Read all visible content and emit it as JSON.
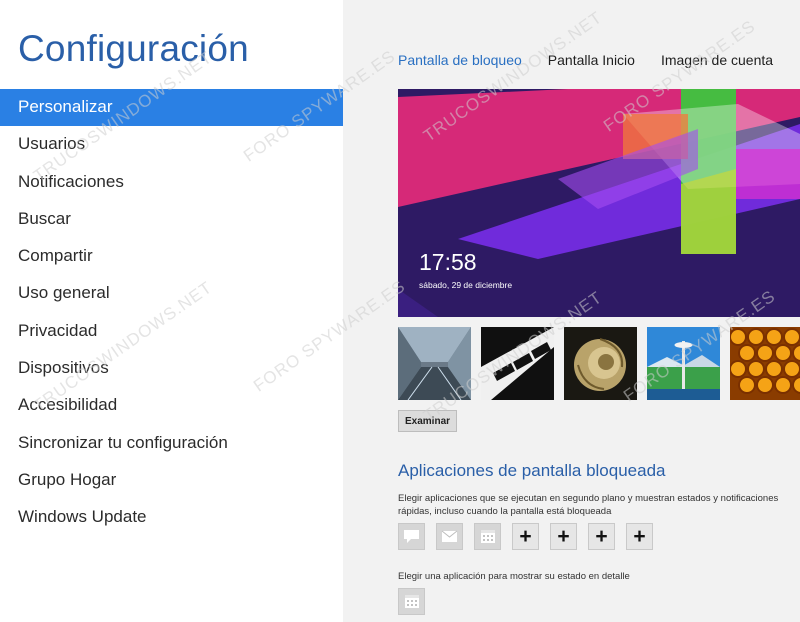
{
  "app": {
    "title": "Configuración"
  },
  "menu": {
    "items": [
      {
        "label": "Personalizar",
        "selected": true
      },
      {
        "label": "Usuarios",
        "selected": false
      },
      {
        "label": "Notificaciones",
        "selected": false
      },
      {
        "label": "Buscar",
        "selected": false
      },
      {
        "label": "Compartir",
        "selected": false
      },
      {
        "label": "Uso general",
        "selected": false
      },
      {
        "label": "Privacidad",
        "selected": false
      },
      {
        "label": "Dispositivos",
        "selected": false
      },
      {
        "label": "Accesibilidad",
        "selected": false
      },
      {
        "label": "Sincronizar tu configuración",
        "selected": false
      },
      {
        "label": "Grupo Hogar",
        "selected": false
      },
      {
        "label": "Windows Update",
        "selected": false
      }
    ]
  },
  "tabs": [
    {
      "label": "Pantalla de bloqueo",
      "active": true
    },
    {
      "label": "Pantalla Inicio",
      "active": false
    },
    {
      "label": "Imagen de cuenta",
      "active": false
    }
  ],
  "lock_preview": {
    "time": "17:58",
    "date": "sábado, 29 de diciembre"
  },
  "thumbnails": [
    {
      "name": "tunnel-thumbnail"
    },
    {
      "name": "piano-thumbnail"
    },
    {
      "name": "nautilus-thumbnail"
    },
    {
      "name": "space-needle-thumbnail"
    },
    {
      "name": "honeycomb-thumbnail"
    }
  ],
  "browse_button": "Examinar",
  "lock_apps": {
    "title": "Aplicaciones de pantalla bloqueada",
    "description": "Elegir aplicaciones que se ejecutan en segundo plano y muestran estados y notificaciones rápidas, incluso cuando la pantalla está bloqueada",
    "slots": [
      {
        "icon": "message-icon",
        "type": "app"
      },
      {
        "icon": "mail-icon",
        "type": "app"
      },
      {
        "icon": "calendar-icon",
        "type": "app"
      },
      {
        "icon": "plus-icon",
        "type": "add",
        "label": "+"
      },
      {
        "icon": "plus-icon",
        "type": "add",
        "label": "+"
      },
      {
        "icon": "plus-icon",
        "type": "add",
        "label": "+"
      },
      {
        "icon": "plus-icon",
        "type": "add",
        "label": "+"
      }
    ],
    "detail_description": "Elegir una aplicación para mostrar su estado en detalle",
    "detail_slot": {
      "icon": "calendar-icon"
    }
  },
  "watermarks": [
    "FORO SPYWARE.ES",
    "TRUCOSWINDOWS.NET"
  ],
  "colors": {
    "accent": "#2a80e4",
    "title_blue": "#2a5fa8",
    "right_bg": "#f2f2f2",
    "preview_bg": "#2e1a64"
  }
}
